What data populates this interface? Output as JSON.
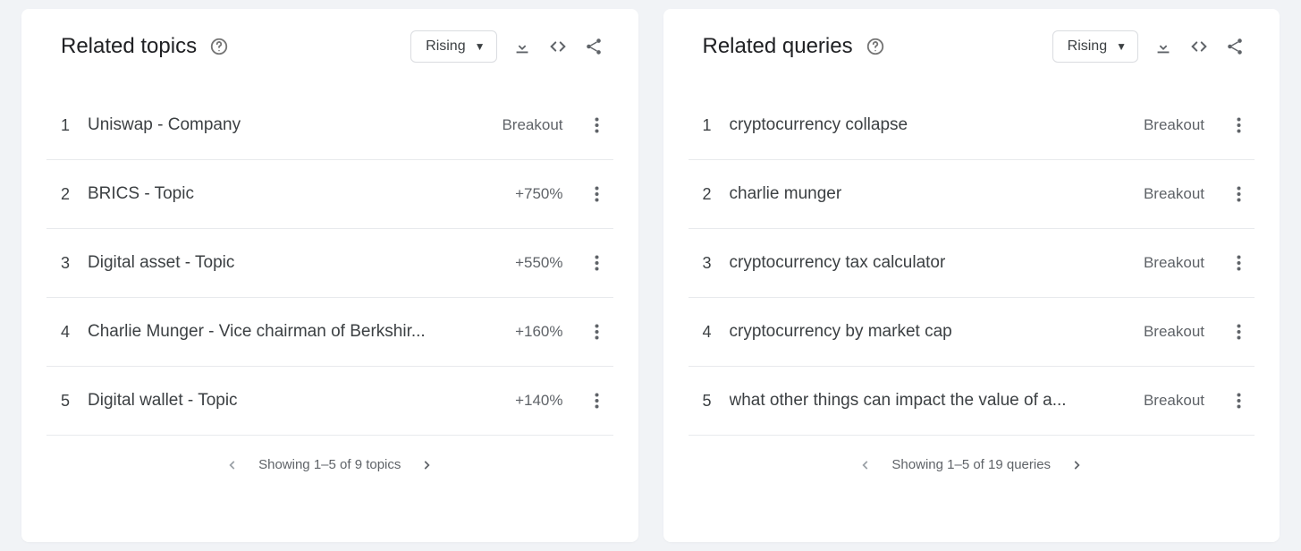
{
  "topics": {
    "title": "Related topics",
    "sort": "Rising",
    "pager": "Showing 1–5 of 9 topics",
    "items": [
      {
        "rank": "1",
        "label": "Uniswap - Company",
        "metric": "Breakout"
      },
      {
        "rank": "2",
        "label": "BRICS - Topic",
        "metric": "+750%"
      },
      {
        "rank": "3",
        "label": "Digital asset - Topic",
        "metric": "+550%"
      },
      {
        "rank": "4",
        "label": "Charlie Munger - Vice chairman of Berkshir...",
        "metric": "+160%"
      },
      {
        "rank": "5",
        "label": "Digital wallet - Topic",
        "metric": "+140%"
      }
    ]
  },
  "queries": {
    "title": "Related queries",
    "sort": "Rising",
    "pager": "Showing 1–5 of 19 queries",
    "items": [
      {
        "rank": "1",
        "label": "cryptocurrency collapse",
        "metric": "Breakout"
      },
      {
        "rank": "2",
        "label": "charlie munger",
        "metric": "Breakout"
      },
      {
        "rank": "3",
        "label": "cryptocurrency tax calculator",
        "metric": "Breakout"
      },
      {
        "rank": "4",
        "label": "cryptocurrency by market cap",
        "metric": "Breakout"
      },
      {
        "rank": "5",
        "label": "what other things can impact the value of a...",
        "metric": "Breakout"
      }
    ]
  }
}
